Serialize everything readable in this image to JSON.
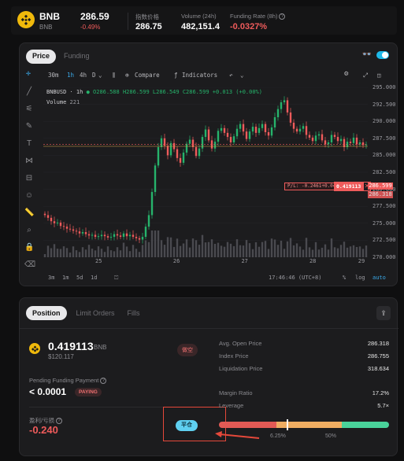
{
  "ticker": {
    "symbol": "BNB",
    "subsymbol": "BNB",
    "price": "286.59",
    "change": "-0.49%",
    "index_label": "指数价格",
    "index_value": "286.75",
    "volume_label": "Volume (24h)",
    "volume_value": "482,151.4",
    "funding_label": "Funding Rate (8h)",
    "funding_value": "-0.0327%"
  },
  "chart_panel": {
    "tabs": [
      {
        "label": "Price",
        "active": true
      },
      {
        "label": "Funding",
        "active": false
      }
    ],
    "toolbar": {
      "intervals": [
        "30m",
        "1h",
        "4h",
        "D"
      ],
      "active_interval": "1h",
      "compare": "Compare",
      "indicators": "Indicators"
    },
    "legend_line": "BNBUSD · 1h",
    "ohlc": {
      "o": "O286.588",
      "h": "H286.599",
      "l": "L286.549",
      "c": "C286.599",
      "chg": "+0.013 (+0.00%)"
    },
    "volume_label": "Volume",
    "volume_value": "221",
    "order_line_label": "P/L: -0.2461+0.0400",
    "order_line_qty": "0.419113",
    "order_close": "✕",
    "price_tag_last": "286.599",
    "price_tag_entry": "286.318",
    "bottom": {
      "ranges": [
        "3m",
        "1m",
        "5d",
        "1d"
      ],
      "time": "17:46:46 (UTC+8)",
      "percent": "%",
      "log": "log",
      "auto": "auto"
    }
  },
  "chart_data": {
    "type": "candlestick",
    "title": "",
    "ylim": [
      270.0,
      295.0
    ],
    "y_ticks": [
      "295.000",
      "292.500",
      "290.000",
      "287.500",
      "285.000",
      "282.500",
      "280.000",
      "277.500",
      "275.000",
      "272.500",
      "270.000"
    ],
    "x_ticks": [
      "25",
      "26",
      "27",
      "28",
      "29"
    ],
    "close": [
      276.2,
      275.8,
      275.3,
      275.0,
      275.1,
      274.6,
      274.5,
      274.2,
      274.1,
      273.9,
      273.8,
      273.5,
      273.7,
      273.4,
      273.2,
      273.3,
      273.0,
      273.1,
      273.3,
      273.1,
      272.9,
      273.0,
      273.4,
      273.2,
      273.0,
      273.5,
      273.1,
      273.3,
      273.0,
      272.8,
      272.6,
      273.0,
      274.5,
      276.2,
      279.6,
      283.5,
      286.2,
      287.5,
      286.4,
      285.0,
      286.8,
      285.9,
      284.6,
      283.9,
      285.4,
      286.7,
      287.3,
      286.2,
      284.9,
      286.0,
      287.7,
      288.8,
      287.2,
      286.0,
      287.0,
      288.6,
      289.0,
      288.3,
      287.7,
      286.9,
      287.8,
      288.9,
      289.6,
      288.5,
      287.4,
      288.5,
      289.2,
      288.3,
      289.0,
      289.6,
      288.4,
      287.9,
      289.1,
      290.6,
      291.8,
      292.8,
      293.1,
      291.3,
      289.8,
      288.9,
      288.5,
      288.9,
      289.3,
      288.0,
      287.6,
      287.1,
      287.9,
      288.1,
      287.2,
      286.6,
      286.9,
      288.0,
      287.7,
      287.1,
      287.4,
      286.2,
      287.0,
      286.8,
      287.6,
      286.6,
      286.9,
      286.5,
      286.6
    ],
    "volume_note": "Volume histogram"
  },
  "position_panel": {
    "tabs": [
      {
        "label": "Position",
        "active": true
      },
      {
        "label": "Limit Orders",
        "active": false
      },
      {
        "label": "Fills",
        "active": false
      }
    ],
    "quantity": "0.419113",
    "quantity_unit": "BNB",
    "quantity_usd": "$120.117",
    "side_badge": "做空",
    "funding_label": "Pending Funding Payment",
    "funding_value": "< 0.0001",
    "funding_badge": "PAYING",
    "pnl_label": "盈利/亏损",
    "pnl_value": "-0.240",
    "close_button": "平仓",
    "stats": [
      {
        "label": "Avg. Open Price",
        "value": "286.318"
      },
      {
        "label": "Index Price",
        "value": "286.755"
      },
      {
        "label": "Liquidation Price",
        "value": "318.634"
      }
    ],
    "stats2": [
      {
        "label": "Margin Ratio",
        "value": "17.2%"
      },
      {
        "label": "Leverage",
        "value": "5.7×"
      }
    ],
    "margin_bar": {
      "marker_fraction": 0.4,
      "tick_low": "6.25%",
      "tick_high": "50%"
    }
  },
  "colors": {
    "accent": "#1fb9e8",
    "up": "#26b36b",
    "down": "#ef5b5b",
    "brand": "#f0b90b"
  }
}
